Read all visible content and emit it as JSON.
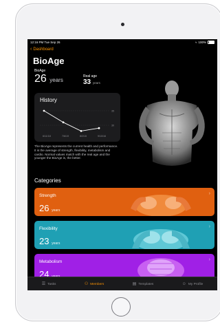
{
  "status": {
    "time": "12:16 PM  Tue Sep 26",
    "battery": "100%"
  },
  "nav": {
    "back_label": "Dashboard"
  },
  "page": {
    "title": "BioAge"
  },
  "bioage": {
    "label": "BioAge",
    "value": "26",
    "unit": "years"
  },
  "real_age": {
    "label": "Real age",
    "value": "33",
    "unit": "years"
  },
  "history": {
    "title": "History",
    "dates": [
      "6/11/18",
      "7/6/19",
      "8/2/15",
      "9/10/16"
    ],
    "y_ticks": [
      "35",
      "30"
    ],
    "points": [
      35,
      31,
      28,
      29
    ]
  },
  "description": "The BioAge represents the current health and performance. It is the average of strength, flexibility, metabolism and cardio. Normal values match with the real age and the younger the BioAge is, the better.",
  "categories_heading": "Categories",
  "categories": [
    {
      "name": "Strength",
      "value": "26",
      "unit": "years",
      "color": "#e06010"
    },
    {
      "name": "Flexibility",
      "value": "23",
      "unit": "years",
      "color": "#1fa0b4"
    },
    {
      "name": "Metabolism",
      "value": "24",
      "unit": "years",
      "color": "#a020e6"
    }
  ],
  "tabs": [
    {
      "label": "Tasks",
      "icon": "list-icon",
      "active": false
    },
    {
      "label": "Members",
      "icon": "members-icon",
      "active": true
    },
    {
      "label": "Templates",
      "icon": "templates-icon",
      "active": false
    },
    {
      "label": "My Profile",
      "icon": "profile-icon",
      "active": false
    }
  ],
  "colors": {
    "accent": "#ff9500",
    "background": "#000000",
    "card": "#1c1c1e"
  }
}
